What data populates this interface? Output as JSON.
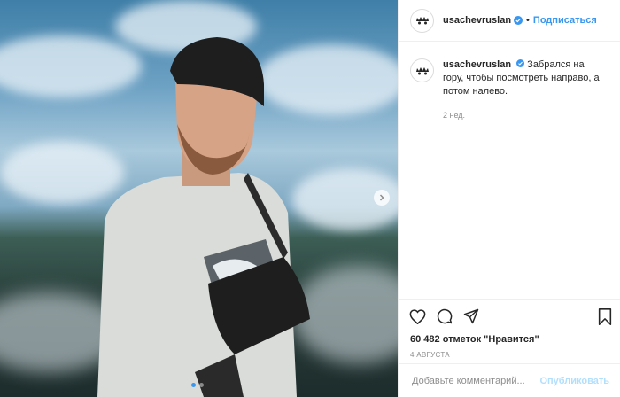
{
  "post": {
    "username": "usachevruslan",
    "follow_label": "Подписаться",
    "separator": "•",
    "caption_text": "Забрался на гору, чтобы посмотреть направо, а потом налево.",
    "time_ago": "2 нед.",
    "likes": "60 482 отметок \"Нравится\"",
    "date": "4 АВГУСТА",
    "comment_placeholder": "Добавьте комментарий...",
    "publish_label": "Опубликовать",
    "carousel": {
      "total": 2,
      "active": 1
    }
  },
  "colors": {
    "accent": "#3897f0",
    "publish_disabled": "#b2dffc",
    "text": "#262626",
    "muted": "#8e8e8e"
  },
  "icons": [
    "verified-badge-icon",
    "heart-icon",
    "comment-icon",
    "share-icon",
    "bookmark-icon",
    "chevron-right-icon"
  ]
}
